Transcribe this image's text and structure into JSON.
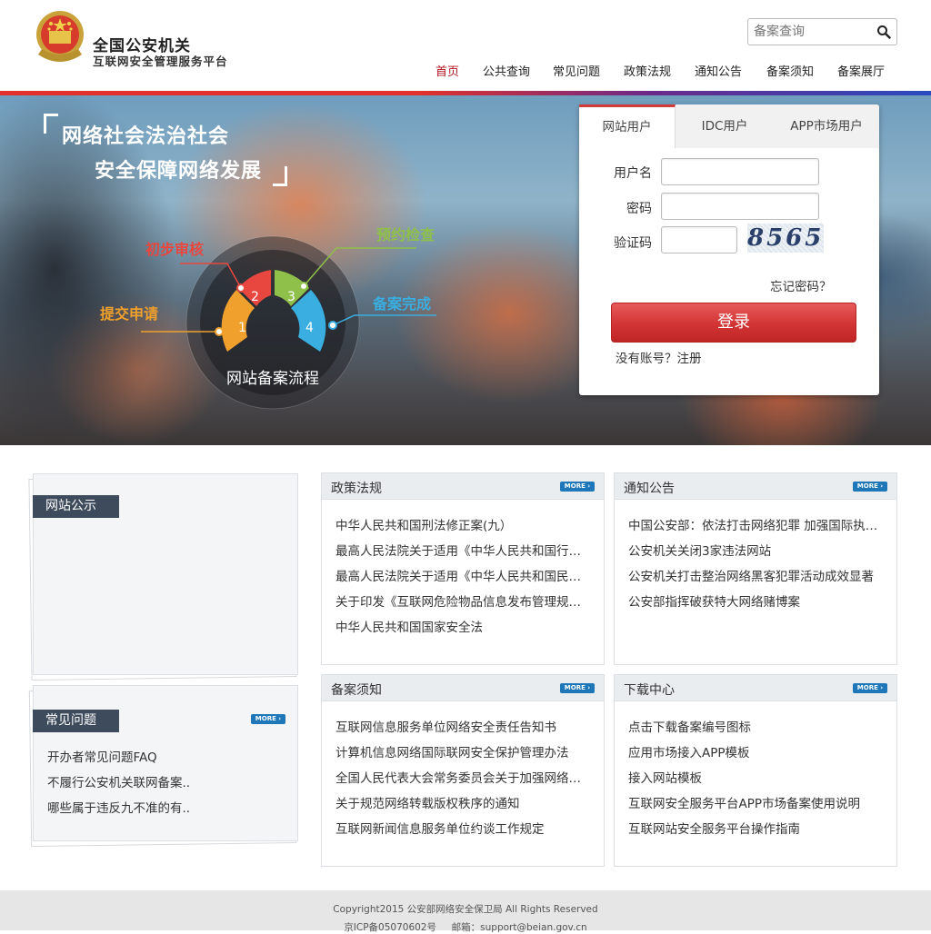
{
  "header": {
    "title": "全国公安机关",
    "subtitle": "互联网安全管理服务平台",
    "search_placeholder": "备案查询",
    "nav": [
      "首页",
      "公共查询",
      "常见问题",
      "政策法规",
      "通知公告",
      "备案须知",
      "备案展厅"
    ],
    "nav_active_index": 0
  },
  "banner": {
    "slogan_line1": "网络社会法治社会",
    "slogan_line2": "安全保障网络发展",
    "flow_title": "网站备案流程",
    "steps": [
      {
        "num": "1",
        "label": "提交申请",
        "color": "#f0a02c"
      },
      {
        "num": "2",
        "label": "初步审核",
        "color": "#e8473f"
      },
      {
        "num": "3",
        "label": "预约检查",
        "color": "#8ec04a"
      },
      {
        "num": "4",
        "label": "备案完成",
        "color": "#3aaee0"
      }
    ]
  },
  "login": {
    "tabs": [
      "网站用户",
      "IDC用户",
      "APP市场用户"
    ],
    "active_tab": 0,
    "username_label": "用户名",
    "password_label": "密码",
    "captcha_label": "验证码",
    "captcha_text": "8565",
    "forgot": "忘记密码？",
    "login_button": "登录",
    "register": "没有账号？注册"
  },
  "sidebar": {
    "notice_title": "网站公示",
    "faq_title": "常见问题",
    "more_label": "MORE",
    "faq_items": [
      "开办者常见问题FAQ",
      "不履行公安机关联网备案..",
      "哪些属于违反九不准的有.."
    ]
  },
  "panels": {
    "policy": {
      "title": "政策法规",
      "items": [
        "中华人民共和国刑法修正案(九）",
        "最高人民法院关于适用《中华人民共和国行政诉讼法》的解释",
        "最高人民法院关于适用《中华人民共和国民事诉讼法》的解释",
        "关于印发《互联网危险物品信息发布管理规定》的通知",
        "中华人民共和国国家安全法"
      ]
    },
    "notice": {
      "title": "通知公告",
      "items": [
        "中国公安部：依法打击网络犯罪 加强国际执法合作",
        "公安机关关闭3家违法网站",
        "公安机关打击整治网络黑客犯罪活动成效显著",
        "公安部指挥破获特大网络赌博案"
      ]
    },
    "filing": {
      "title": "备案须知",
      "items": [
        "互联网信息服务单位网络安全责任告知书",
        "计算机信息网络国际联网安全保护管理办法",
        "全国人民代表大会常务委员会关于加强网络信息保护的决定",
        "关于规范网络转载版权秩序的通知",
        "互联网新闻信息服务单位约谈工作规定"
      ]
    },
    "download": {
      "title": "下载中心",
      "items": [
        "点击下载备案编号图标",
        "应用市场接入APP模板",
        "接入网站模板",
        "互联网安全服务平台APP市场备案使用说明",
        "互联网站安全服务平台操作指南"
      ]
    }
  },
  "footer": {
    "copyright": "Copyright2015 公安部网络安全保卫局 All Rights Reserved",
    "icp": "京ICP备05070602号     邮箱：support@beian.gov.cn"
  }
}
